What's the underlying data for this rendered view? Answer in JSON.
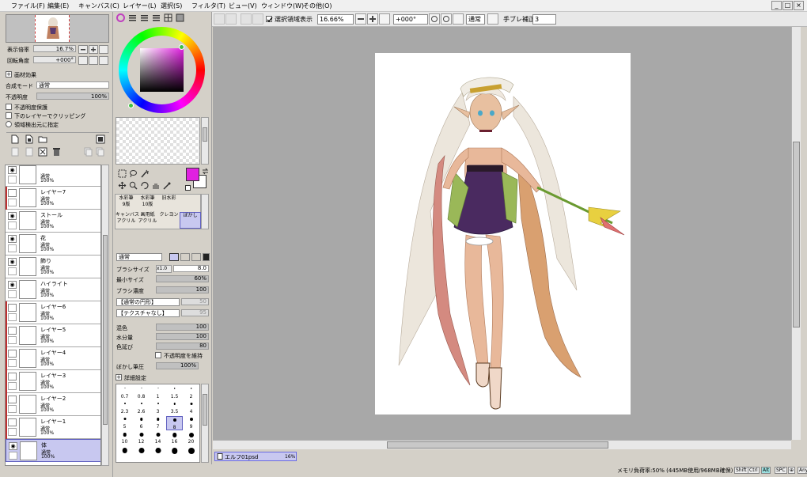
{
  "menu": [
    "ファイル(F)",
    "編集(E)",
    "キャンバス(C)",
    "レイヤー(L)",
    "選択(S)",
    "フィルタ(T)",
    "ビュー(V)",
    "ウィンドウ(W)",
    "その他(O)"
  ],
  "window_buttons": {
    "minimize": "_",
    "restore": "□",
    "close": "×"
  },
  "toolbar": {
    "selection_show_label": "選択領域表示",
    "zoom_value": "16.66%",
    "rotation_value": "+000°",
    "blend_mode": "通常",
    "stabilizer_label": "手ブレ補正",
    "stabilizer_value": "3"
  },
  "navigator": {
    "zoom_label": "表示倍率",
    "zoom_value": "16.7%",
    "rotation_label": "回転角度",
    "rotation_value": "+000°"
  },
  "paper_effects": {
    "title": "画材効果",
    "blend_label": "合成モード",
    "blend_value": "通常",
    "opacity_label": "不透明度",
    "opacity_value": "100%",
    "opacity_fraction": 1.0,
    "protect_opacity": "不透明度保護",
    "clip_lower": "下のレイヤーでクリッピング",
    "selection_source": "領域検出元に指定"
  },
  "layers": [
    {
      "name": "",
      "mode": "通常",
      "opacity": "100%",
      "red": false,
      "eye": true,
      "selected": false
    },
    {
      "name": "レイヤー7",
      "mode": "通常",
      "opacity": "100%",
      "red": true,
      "eye": false,
      "selected": false
    },
    {
      "name": "ストール",
      "mode": "通常",
      "opacity": "100%",
      "red": false,
      "eye": true,
      "selected": false
    },
    {
      "name": "花",
      "mode": "通常",
      "opacity": "100%",
      "red": false,
      "eye": true,
      "selected": false
    },
    {
      "name": "飾り",
      "mode": "通常",
      "opacity": "100%",
      "red": false,
      "eye": true,
      "selected": false
    },
    {
      "name": "ハイライト",
      "mode": "通常",
      "opacity": "100%",
      "red": false,
      "eye": true,
      "selected": false
    },
    {
      "name": "レイヤー6",
      "mode": "通常",
      "opacity": "100%",
      "red": true,
      "eye": false,
      "selected": false
    },
    {
      "name": "レイヤー5",
      "mode": "通常",
      "opacity": "100%",
      "red": true,
      "eye": false,
      "selected": false
    },
    {
      "name": "レイヤー4",
      "mode": "通常",
      "opacity": "100%",
      "red": true,
      "eye": false,
      "selected": false
    },
    {
      "name": "レイヤー3",
      "mode": "通常",
      "opacity": "100%",
      "red": true,
      "eye": false,
      "selected": false
    },
    {
      "name": "レイヤー2",
      "mode": "通常",
      "opacity": "100%",
      "red": true,
      "eye": false,
      "selected": false
    },
    {
      "name": "レイヤー1",
      "mode": "通常",
      "opacity": "100%",
      "red": true,
      "eye": false,
      "selected": false
    },
    {
      "name": "体",
      "mode": "通常",
      "opacity": "100%",
      "red": false,
      "eye": true,
      "selected": true
    }
  ],
  "tools": {
    "row1": [
      "水彩筆\n9版",
      "水彩筆\n10版",
      "旧水彩\n"
    ],
    "row2": [
      "キャンバス\nアクリル",
      "画用紙\nアクリル",
      "クレヨン",
      "ぼかし"
    ],
    "active": "ぼかし"
  },
  "brush_panel": {
    "blend": "通常",
    "size_label": "ブラシサイズ",
    "size_mult": "x1.0",
    "size_value": "8.0",
    "min_size_label": "最小サイズ",
    "min_size_value": "60%",
    "density_label": "ブラシ濃度",
    "density_value": "100",
    "shape_label": "【通常の円形】",
    "shape_value": "50",
    "texture_label": "【テクスチャなし】",
    "texture_value": "95",
    "mix_label": "混色",
    "mix_value": "100",
    "water_label": "水分量",
    "water_value": "100",
    "stretch_label": "色延び",
    "stretch_value": "80",
    "keep_opacity": "不透明度を維持",
    "blur_label": "ぼかし筆圧",
    "blur_value": "100%",
    "detail_label": "詳細設定"
  },
  "brush_sizes": [
    "0.7",
    "0.8",
    "1",
    "1.5",
    "2",
    "2.3",
    "2.6",
    "3",
    "3.5",
    "4",
    "5",
    "6",
    "7",
    "8",
    "9",
    "10",
    "12",
    "14",
    "16",
    "20",
    "",
    "",
    "",
    "",
    ""
  ],
  "brush_selected_index": 13,
  "colors": {
    "foreground": "#e020e0",
    "background": "#ffffff",
    "accent": "#6a6ae0"
  },
  "tab": {
    "filename": "エルフ01psd",
    "zoom": "16%"
  },
  "status": {
    "memory": "メモリ負荷率:50% (445MB使用/968MB確保)",
    "keys": [
      "Shift",
      "Ctrl",
      "Alt",
      "SPC",
      "⊕",
      "Any"
    ]
  }
}
